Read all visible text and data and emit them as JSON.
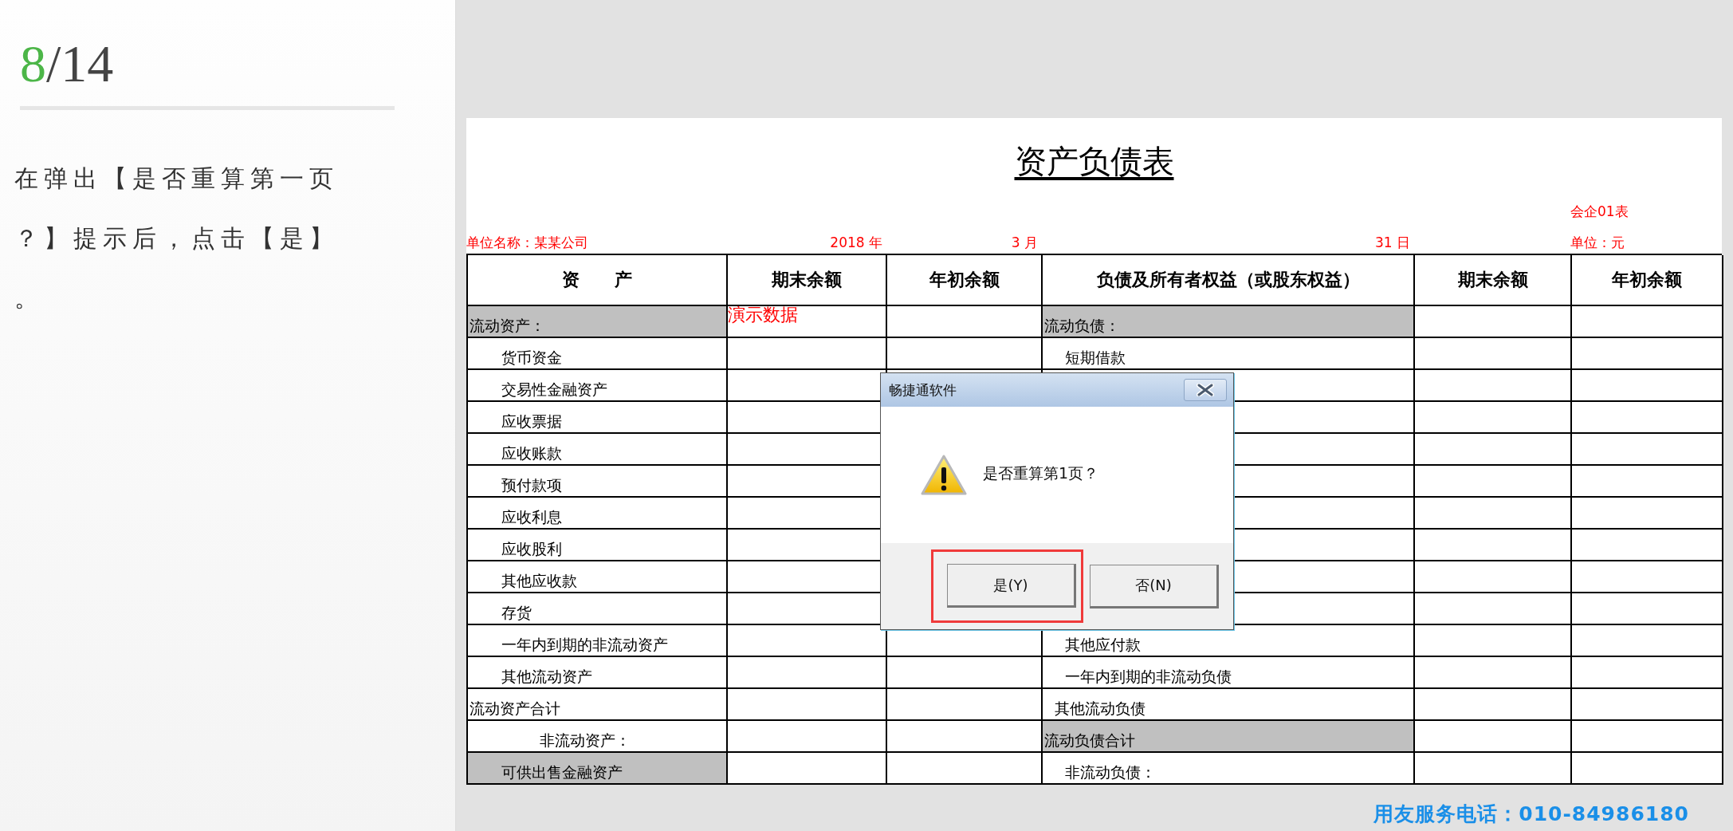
{
  "guide": {
    "step": "8",
    "total": "/14",
    "text": "在弹出【是否重算第一页？】提示后，点击【是】。"
  },
  "sheet": {
    "title": "资产负债表",
    "company": "单位名称：某某公司",
    "year": "2018 年",
    "month": "3 月",
    "day": "31 日",
    "form_no": "会企01表",
    "unit": "单位：元",
    "columns": [
      "资　　产",
      "期末余额",
      "年初余额",
      "负债及所有者权益（或股东权益）",
      "期末余额",
      "年初余额"
    ],
    "rows": [
      {
        "asset": {
          "text": "流动资产：",
          "kind": "section",
          "shaded": true
        },
        "note": "演示数据",
        "liability": {
          "text": "流动负债：",
          "kind": "section",
          "shaded": true
        }
      },
      {
        "asset": {
          "text": "货币资金",
          "kind": "item",
          "shaded": false
        },
        "liability": {
          "text": "短期借款",
          "kind": "item",
          "shaded": false
        }
      },
      {
        "asset": {
          "text": "交易性金融资产",
          "kind": "item",
          "shaded": false
        }
      },
      {
        "asset": {
          "text": "应收票据",
          "kind": "item",
          "shaded": false
        }
      },
      {
        "asset": {
          "text": "应收账款",
          "kind": "item",
          "shaded": false
        }
      },
      {
        "asset": {
          "text": "预付款项",
          "kind": "item",
          "shaded": false
        }
      },
      {
        "asset": {
          "text": "应收利息",
          "kind": "item",
          "shaded": false
        }
      },
      {
        "asset": {
          "text": "应收股利",
          "kind": "item",
          "shaded": false
        }
      },
      {
        "asset": {
          "text": "其他应收款",
          "kind": "item",
          "shaded": false
        }
      },
      {
        "asset": {
          "text": "存货",
          "kind": "item",
          "shaded": false
        }
      },
      {
        "asset": {
          "text": "一年内到期的非流动资产",
          "kind": "item",
          "shaded": false
        },
        "liability": {
          "text": "其他应付款",
          "kind": "item",
          "shaded": false
        }
      },
      {
        "asset": {
          "text": "其他流动资产",
          "kind": "item",
          "shaded": false
        },
        "liability": {
          "text": "一年内到期的非流动负债",
          "kind": "item",
          "shaded": false
        }
      },
      {
        "asset": {
          "text": "流动资产合计",
          "kind": "section",
          "shaded": false
        },
        "liability": {
          "text": "其他流动负债",
          "kind": "minor",
          "shaded": false
        }
      },
      {
        "asset": {
          "text": "非流动资产：",
          "kind": "subsection",
          "shaded": false
        },
        "liability": {
          "text": "流动负债合计",
          "kind": "section",
          "shaded": true
        }
      },
      {
        "asset": {
          "text": "可供出售金融资产",
          "kind": "item",
          "shaded": true
        },
        "liability": {
          "text": "非流动负债：",
          "kind": "item",
          "shaded": false
        }
      }
    ]
  },
  "dialog": {
    "title": "畅捷通软件",
    "message": "是否重算第1页？",
    "buttons": [
      {
        "label": "是(Y)",
        "highlighted": true
      },
      {
        "label": "否(N)",
        "highlighted": false
      }
    ]
  },
  "footer": "用友服务电话：010-84986180"
}
